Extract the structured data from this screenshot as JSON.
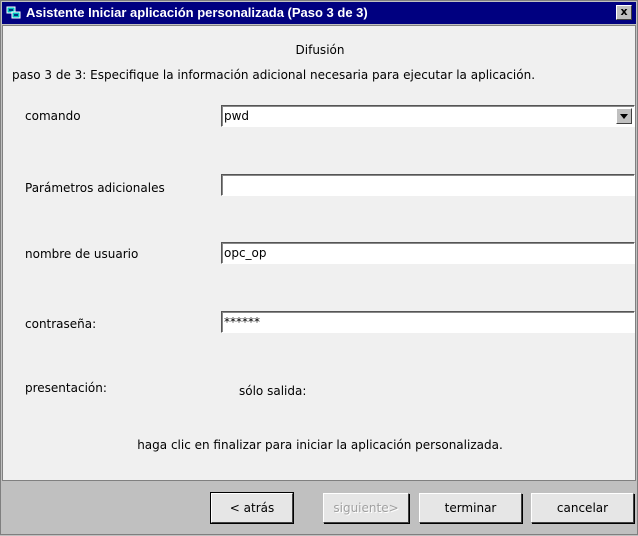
{
  "window": {
    "title": "Asistente Iniciar aplicación personalizada (Paso 3 de 3)",
    "close_label": "x"
  },
  "header": {
    "subtitle": "Difusión",
    "instructions": "paso 3 de 3: Especifique la información adicional necesaria para ejecutar la aplicación."
  },
  "form": {
    "command": {
      "label": "comando",
      "value": "pwd"
    },
    "params": {
      "label": "Parámetros adicionales",
      "value": ""
    },
    "username": {
      "label": "nombre de usuario",
      "value": "opc_op"
    },
    "password": {
      "label": "contraseña:",
      "value": "******"
    },
    "presentation": {
      "label": "presentación:",
      "value": "sólo salida:"
    }
  },
  "footer_note": "haga clic en finalizar para iniciar la aplicación personalizada.",
  "buttons": {
    "back": "< atrás",
    "next": "siguiente>",
    "finish": "terminar",
    "cancel": "cancelar"
  },
  "colors": {
    "titlebar": "#000080",
    "panel": "#f0f0f0",
    "frame": "#c0c0c0"
  }
}
